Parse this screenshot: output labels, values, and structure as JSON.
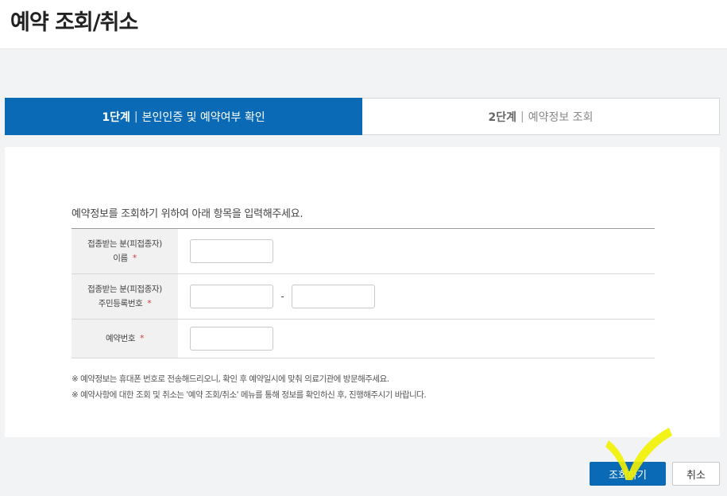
{
  "page": {
    "title": "예약 조회/취소"
  },
  "steps": [
    {
      "num": "1단계",
      "label": "본인인증 및 예약여부 확인",
      "active": true
    },
    {
      "num": "2단계",
      "label": "예약정보 조회",
      "active": false
    }
  ],
  "form": {
    "intro": "예약정보를 조회하기 위하여 아래 항목을 입력해주세요.",
    "name_label_line1": "접종받는 분(피접종자)",
    "name_label_line2": "이름",
    "rrn_label_line1": "접종받는 분(피접종자)",
    "rrn_label_line2": "주민등록번호",
    "rrn_separator": "-",
    "reservation_label": "예약번호",
    "required_mark": "*",
    "name_value": "",
    "rrn_front_value": "",
    "rrn_back_value": "",
    "reservation_value": ""
  },
  "notes": [
    "※ 예약정보는 휴대폰 번호로 전송해드리오니, 확인 후 예약일시에 맞춰 의료기관에 방문해주세요.",
    "※ 예약사항에 대한 조회 및 취소는 '예약 조회/취소' 메뉴를 통해 정보를 확인하신 후, 진행해주시기 바랍니다."
  ],
  "buttons": {
    "search": "조회하기",
    "cancel": "취소"
  },
  "colors": {
    "primary": "#0a6ab5",
    "required": "#d43b3b",
    "highlight_mark": "#f2f200"
  }
}
